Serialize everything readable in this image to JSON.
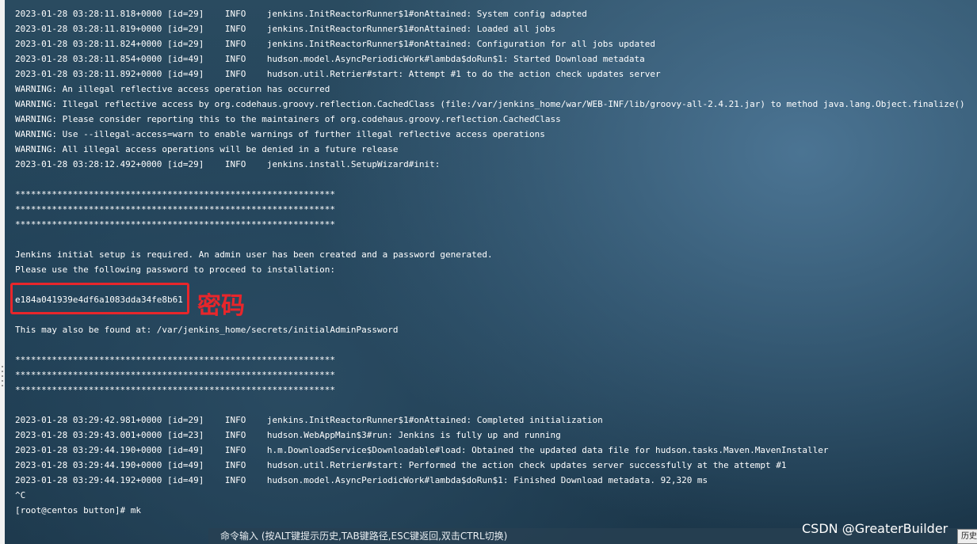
{
  "terminal": {
    "lines": [
      "2023-01-28 03:28:11.818+0000 [id=29]    INFO    jenkins.InitReactorRunner$1#onAttained: System config adapted",
      "2023-01-28 03:28:11.819+0000 [id=29]    INFO    jenkins.InitReactorRunner$1#onAttained: Loaded all jobs",
      "2023-01-28 03:28:11.824+0000 [id=29]    INFO    jenkins.InitReactorRunner$1#onAttained: Configuration for all jobs updated",
      "2023-01-28 03:28:11.854+0000 [id=49]    INFO    hudson.model.AsyncPeriodicWork#lambda$doRun$1: Started Download metadata",
      "2023-01-28 03:28:11.892+0000 [id=49]    INFO    hudson.util.Retrier#start: Attempt #1 to do the action check updates server",
      "WARNING: An illegal reflective access operation has occurred",
      "WARNING: Illegal reflective access by org.codehaus.groovy.reflection.CachedClass (file:/var/jenkins_home/war/WEB-INF/lib/groovy-all-2.4.21.jar) to method java.lang.Object.finalize()",
      "WARNING: Please consider reporting this to the maintainers of org.codehaus.groovy.reflection.CachedClass",
      "WARNING: Use --illegal-access=warn to enable warnings of further illegal reflective access operations",
      "WARNING: All illegal access operations will be denied in a future release",
      "2023-01-28 03:28:12.492+0000 [id=29]    INFO    jenkins.install.SetupWizard#init:",
      "",
      "*************************************************************",
      "*************************************************************",
      "*************************************************************",
      "",
      "Jenkins initial setup is required. An admin user has been created and a password generated.",
      "Please use the following password to proceed to installation:",
      "",
      "e184a041939e4df6a1083dda34fe8b61",
      "",
      "This may also be found at: /var/jenkins_home/secrets/initialAdminPassword",
      "",
      "*************************************************************",
      "*************************************************************",
      "*************************************************************",
      "",
      "2023-01-28 03:29:42.981+0000 [id=29]    INFO    jenkins.InitReactorRunner$1#onAttained: Completed initialization",
      "2023-01-28 03:29:43.001+0000 [id=23]    INFO    hudson.WebAppMain$3#run: Jenkins is fully up and running",
      "2023-01-28 03:29:44.190+0000 [id=49]    INFO    h.m.DownloadService$Downloadable#load: Obtained the updated data file for hudson.tasks.Maven.MavenInstaller",
      "2023-01-28 03:29:44.190+0000 [id=49]    INFO    hudson.util.Retrier#start: Performed the action check updates server successfully at the attempt #1",
      "2023-01-28 03:29:44.192+0000 [id=49]    INFO    hudson.model.AsyncPeriodicWork#lambda$doRun$1: Finished Download metadata. 92,320 ms",
      "^C",
      "[root@centos button]# mk"
    ]
  },
  "annotation": {
    "label": "密码",
    "color": "#e8262b"
  },
  "command_bar": {
    "hint": "命令输入 (按ALT键提示历史,TAB键路径,ESC键返回,双击CTRL切换)"
  },
  "watermark": "CSDN @GreaterBuilder",
  "history_button": {
    "label": "历史"
  },
  "colors": {
    "terminal_text": "#ffffff",
    "highlight": "#e8262b"
  }
}
